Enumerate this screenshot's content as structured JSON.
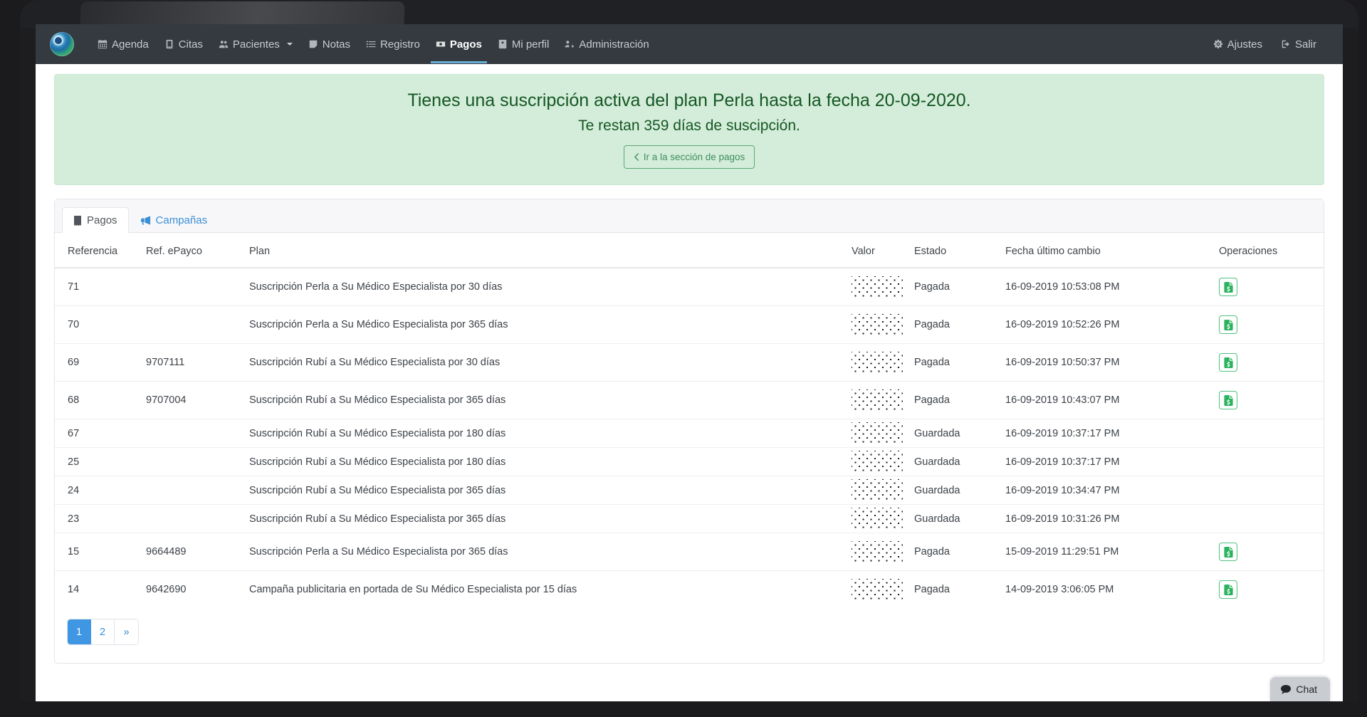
{
  "navbar": {
    "brand_name": "su-medico-especialista-logo",
    "items": [
      {
        "label": "Agenda",
        "icon": "calendar-icon",
        "active": false,
        "caret": false
      },
      {
        "label": "Citas",
        "icon": "book-icon",
        "active": false,
        "caret": false
      },
      {
        "label": "Pacientes",
        "icon": "users-icon",
        "active": false,
        "caret": true
      },
      {
        "label": "Notas",
        "icon": "sticky-note-icon",
        "active": false,
        "caret": false
      },
      {
        "label": "Registro",
        "icon": "list-icon",
        "active": false,
        "caret": false
      },
      {
        "label": "Pagos",
        "icon": "money-icon",
        "active": true,
        "caret": false
      },
      {
        "label": "Mi perfil",
        "icon": "id-card-icon",
        "active": false,
        "caret": false
      },
      {
        "label": "Administración",
        "icon": "user-cog-icon",
        "active": false,
        "caret": false
      }
    ],
    "right_items": [
      {
        "label": "Ajustes",
        "icon": "gear-icon"
      },
      {
        "label": "Salir",
        "icon": "sign-out-icon"
      }
    ]
  },
  "alert": {
    "line1": "Tienes una suscripción activa del plan Perla hasta la fecha 20-09-2020.",
    "line2": "Te restan 359 días de suscipción.",
    "button_label": "Ir a la sección de pagos",
    "button_icon": "chevron-left-icon",
    "bg_color": "#d4edda",
    "text_color": "#155724"
  },
  "tabs": [
    {
      "label": "Pagos",
      "icon": "receipt-icon",
      "active": true
    },
    {
      "label": "Campañas",
      "icon": "megaphone-icon",
      "active": false
    }
  ],
  "table": {
    "columns": [
      "Referencia",
      "Ref. ePayco",
      "Plan",
      "Valor",
      "Estado",
      "Fecha último cambio",
      "Operaciones"
    ],
    "rows": [
      {
        "referencia": "71",
        "epayco": "",
        "plan": "Suscripción Perla a Su Médico Especialista por 30 días",
        "valor": "",
        "estado": "Pagada",
        "fecha": "16-09-2019 10:53:08 PM",
        "action": "invoice-icon"
      },
      {
        "referencia": "70",
        "epayco": "",
        "plan": "Suscripción Perla a Su Médico Especialista por 365 días",
        "valor": "",
        "estado": "Pagada",
        "fecha": "16-09-2019 10:52:26 PM",
        "action": "invoice-icon"
      },
      {
        "referencia": "69",
        "epayco": "9707111",
        "plan": "Suscripción Rubí a Su Médico Especialista por 30 días",
        "valor": "",
        "estado": "Pagada",
        "fecha": "16-09-2019 10:50:37 PM",
        "action": "invoice-icon"
      },
      {
        "referencia": "68",
        "epayco": "9707004",
        "plan": "Suscripción Rubí a Su Médico Especialista por 365 días",
        "valor": "",
        "estado": "Pagada",
        "fecha": "16-09-2019 10:43:07 PM",
        "action": "invoice-icon"
      },
      {
        "referencia": "67",
        "epayco": "",
        "plan": "Suscripción Rubí a Su Médico Especialista por 180 días",
        "valor": "",
        "estado": "Guardada",
        "fecha": "16-09-2019 10:37:17 PM",
        "action": ""
      },
      {
        "referencia": "25",
        "epayco": "",
        "plan": "Suscripción Rubí a Su Médico Especialista por 180 días",
        "valor": "",
        "estado": "Guardada",
        "fecha": "16-09-2019 10:37:17 PM",
        "action": ""
      },
      {
        "referencia": "24",
        "epayco": "",
        "plan": "Suscripción Rubí a Su Médico Especialista por 365 días",
        "valor": "",
        "estado": "Guardada",
        "fecha": "16-09-2019 10:34:47 PM",
        "action": ""
      },
      {
        "referencia": "23",
        "epayco": "",
        "plan": "Suscripción Rubí a Su Médico Especialista por 365 días",
        "valor": "",
        "estado": "Guardada",
        "fecha": "16-09-2019 10:31:26 PM",
        "action": ""
      },
      {
        "referencia": "15",
        "epayco": "9664489",
        "plan": "Suscripción Perla a Su Médico Especialista por 365 días",
        "valor": "",
        "estado": "Pagada",
        "fecha": "15-09-2019 11:29:51 PM",
        "action": "invoice-icon"
      },
      {
        "referencia": "14",
        "epayco": "9642690",
        "plan": "Campaña publicitaria en portada de Su Médico Especialista por 15 días",
        "valor": "",
        "estado": "Pagada",
        "fecha": "14-09-2019 3:06:05 PM",
        "action": "invoice-icon"
      }
    ]
  },
  "pagination": {
    "pages": [
      {
        "label": "1",
        "active": true
      },
      {
        "label": "2",
        "active": false
      },
      {
        "label": "»",
        "active": false
      }
    ]
  },
  "chat": {
    "label": "Chat",
    "icon": "chat-bubble-icon"
  },
  "colors": {
    "navbar_bg": "#343a40",
    "accent_blue": "#3f96e2",
    "success_green": "#2cb35f",
    "alert_green_bg": "#d4edda"
  }
}
